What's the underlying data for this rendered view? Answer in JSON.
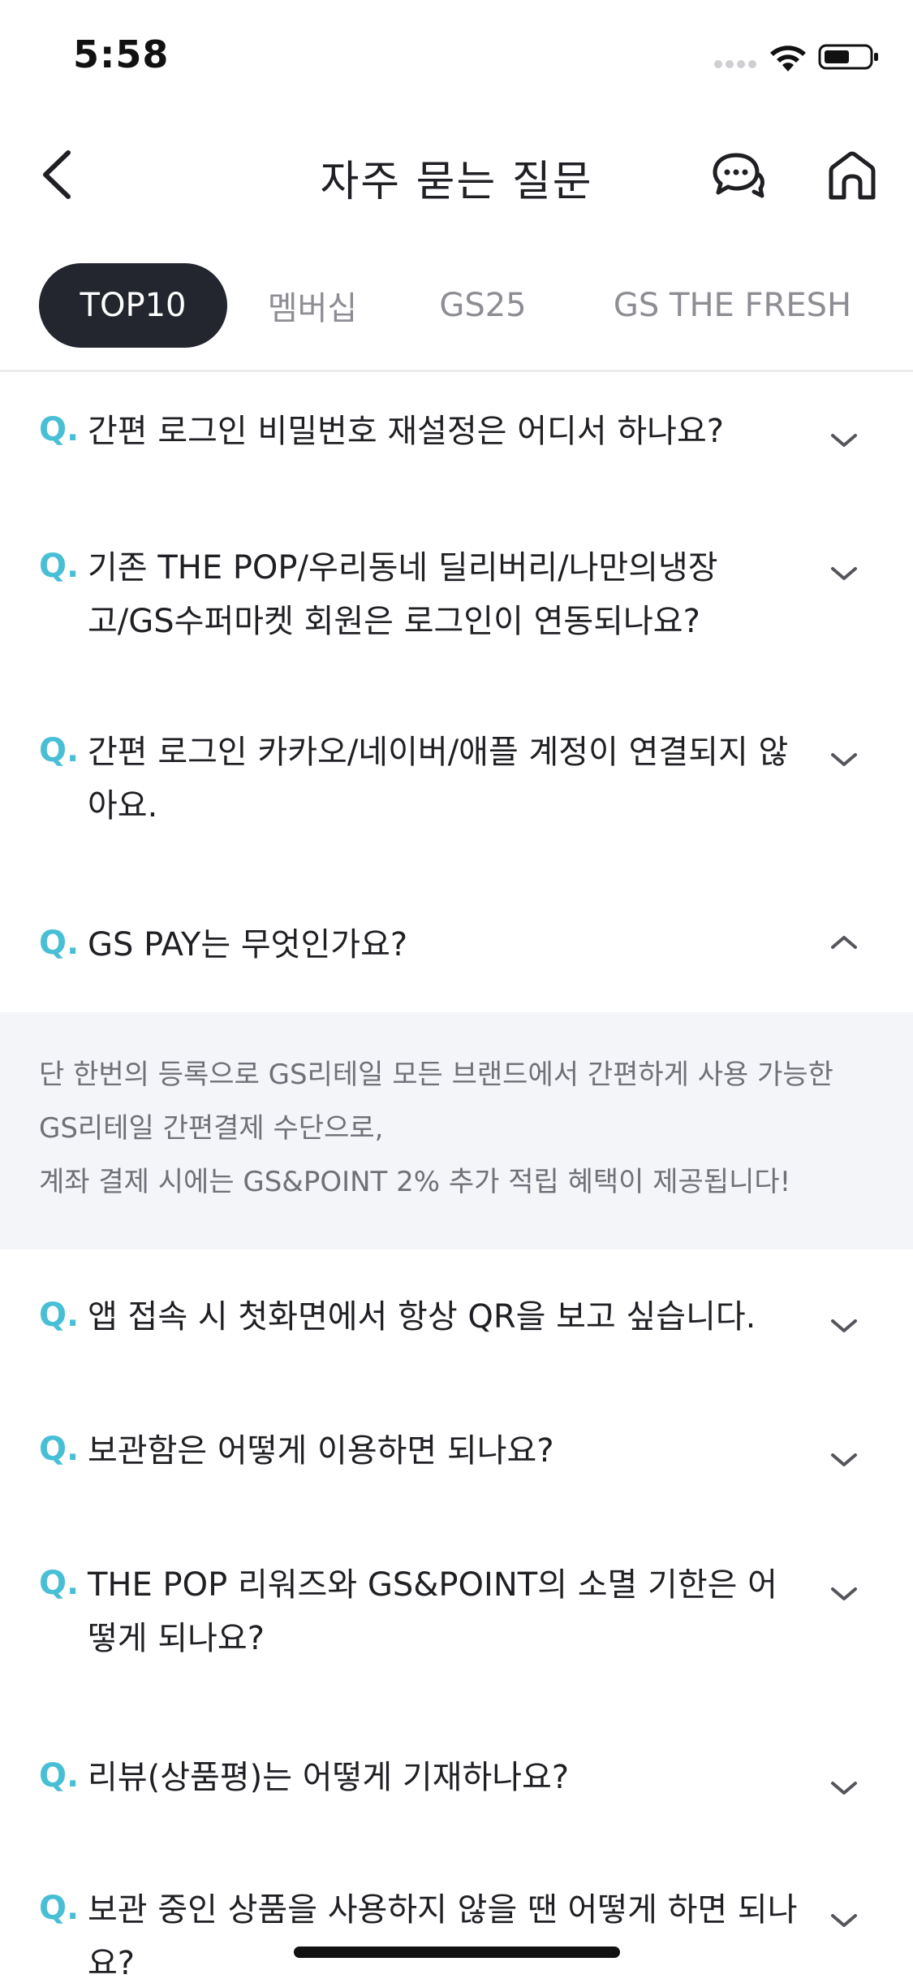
{
  "status_bar": {
    "time": "5:58"
  },
  "header": {
    "title": "자주 묻는 질문",
    "back_icon": "chevron-left-icon",
    "chat_icon": "chat-bubble-icon",
    "home_icon": "home-icon"
  },
  "tabs": [
    {
      "label": "TOP10",
      "active": true
    },
    {
      "label": "멤버십",
      "active": false
    },
    {
      "label": "GS25",
      "active": false
    },
    {
      "label": "GS THE FRESH",
      "active": false
    }
  ],
  "faq": {
    "prefix": "Q.",
    "items": [
      {
        "question": "간편 로그인 비밀번호 재설정은 어디서 하나요?",
        "expanded": false
      },
      {
        "question": "기존 THE POP/우리동네 딜리버리/나만의냉장고/GS수퍼마켓 회원은 로그인이 연동되나요?",
        "expanded": false
      },
      {
        "question": "간편 로그인 카카오/네이버/애플 계정이 연결되지 않아요.",
        "expanded": false
      },
      {
        "question": "GS PAY는 무엇인가요?",
        "expanded": true,
        "answer": "단 한번의 등록으로 GS리테일 모든 브랜드에서 간편하게 사용 가능한 GS리테일 간편결제 수단으로,\n계좌 결제 시에는 GS&POINT 2% 추가 적립 혜택이 제공됩니다!"
      },
      {
        "question": "앱 접속 시 첫화면에서 항상 QR을 보고 싶습니다.",
        "expanded": false
      },
      {
        "question": "보관함은 어떻게 이용하면 되나요?",
        "expanded": false
      },
      {
        "question": "THE POP 리워즈와 GS&POINT의 소멸 기한은 어떻게 되나요?",
        "expanded": false
      },
      {
        "question": "리뷰(상품평)는 어떻게 기재하나요?",
        "expanded": false
      },
      {
        "question": "보관 중인 상품을 사용하지 않을 땐 어떻게 하면 되나요?",
        "expanded": false
      }
    ]
  },
  "colors": {
    "accent_q": "#49bfd6",
    "tab_active_bg": "#23262f",
    "answer_bg": "#f4f5f8"
  }
}
